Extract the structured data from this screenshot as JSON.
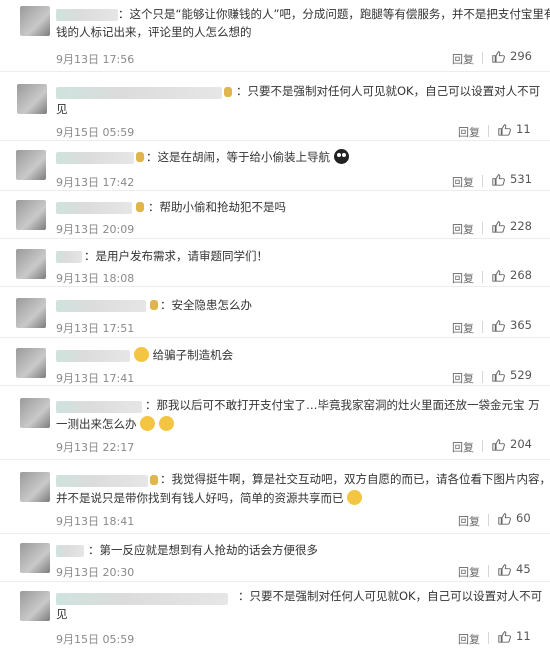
{
  "reply_label": "回复",
  "comments": [
    {
      "line1": "：这个只是“能够让你赚钱的人”吧，分成问题，跑腿等有偿服务，并不是把支付宝里有",
      "line2": "钱的人标记出来，评论里的人怎么想的",
      "time": "9月13日 17:56",
      "likes": "296"
    },
    {
      "line1": "：只要不是强制对任何人可见就OK，自己可以设置对人不可",
      "line2": "见",
      "time": "9月15日 05:59",
      "likes": "11"
    },
    {
      "line1": "：这是在胡闹，等于给小偷装上导航",
      "time": "9月13日 17:42",
      "likes": "531",
      "emoji": "dark"
    },
    {
      "line1": "：帮助小偷和抢劫犯不是吗",
      "time": "9月13日 20:09",
      "likes": "228"
    },
    {
      "line1": "：是用户发布需求，请审题同学们！",
      "time": "9月13日 18:08",
      "likes": "268"
    },
    {
      "line1": "：安全隐患怎么办",
      "time": "9月13日 17:51",
      "likes": "365"
    },
    {
      "line1": "给骗子制造机会",
      "time": "9月13日 17:41",
      "likes": "529",
      "emoji_before": "yellow"
    },
    {
      "line1": "：那我以后可不敢打开支付宝了…毕竟我家窑洞的灶火里面还放一袋金元宝 万",
      "line2": "一测出来怎么办",
      "time": "9月13日 22:17",
      "likes": "204",
      "emoji2": "yellow"
    },
    {
      "line1": "：我觉得挺牛啊，算是社交互动吧，双方自愿的而已，请各位看下图片内容，",
      "line2": "并不是说只是带你找到有钱人好吗，简单的资源共享而已",
      "time": "9月13日 18:41",
      "likes": "60",
      "emoji2": "yellow"
    },
    {
      "line1": "：第一反应就是想到有人抢劫的话会方便很多",
      "time": "9月13日 20:30",
      "likes": "45"
    },
    {
      "line1": "：只要不是强制对任何人可见就OK，自己可以设置对人不可",
      "line2": "见",
      "time": "9月15日 05:59",
      "likes": "11"
    }
  ]
}
